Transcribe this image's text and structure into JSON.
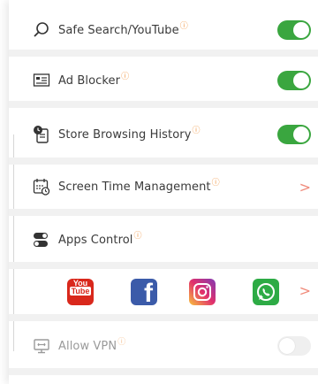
{
  "rows": [
    {
      "label": "Safe Search/YouTube",
      "icon": "search-icon",
      "toggle": "on"
    },
    {
      "label": "Ad Blocker",
      "icon": "ad-blocker-icon",
      "toggle": "on"
    },
    {
      "label": "Store Browsing History",
      "icon": "history-icon",
      "toggle": "on"
    },
    {
      "label": "Screen Time Management",
      "icon": "calendar-clock-icon",
      "control": "chevron"
    },
    {
      "label": "Apps Control",
      "icon": "toggles-icon"
    },
    {
      "label": "Allow VPN",
      "icon": "vpn-icon",
      "toggle": "off",
      "disabled": true
    }
  ],
  "info_marker": "ⓘ",
  "chevron": ">",
  "apps": [
    {
      "name": "YouTube",
      "icon": "youtube-icon",
      "color": "#d9281c",
      "text_top": "You",
      "text_bottom": "Tube"
    },
    {
      "name": "Facebook",
      "icon": "facebook-icon",
      "color": "#3b5ba9",
      "text": "f"
    },
    {
      "name": "Instagram",
      "icon": "instagram-icon",
      "color": "#c13584"
    },
    {
      "name": "WhatsApp",
      "icon": "whatsapp-icon",
      "color": "#2dab45"
    }
  ],
  "colors": {
    "toggle_on": "#3aa63f",
    "toggle_off": "#efefef",
    "info": "#f0913b",
    "chevron": "#f08a7a"
  }
}
